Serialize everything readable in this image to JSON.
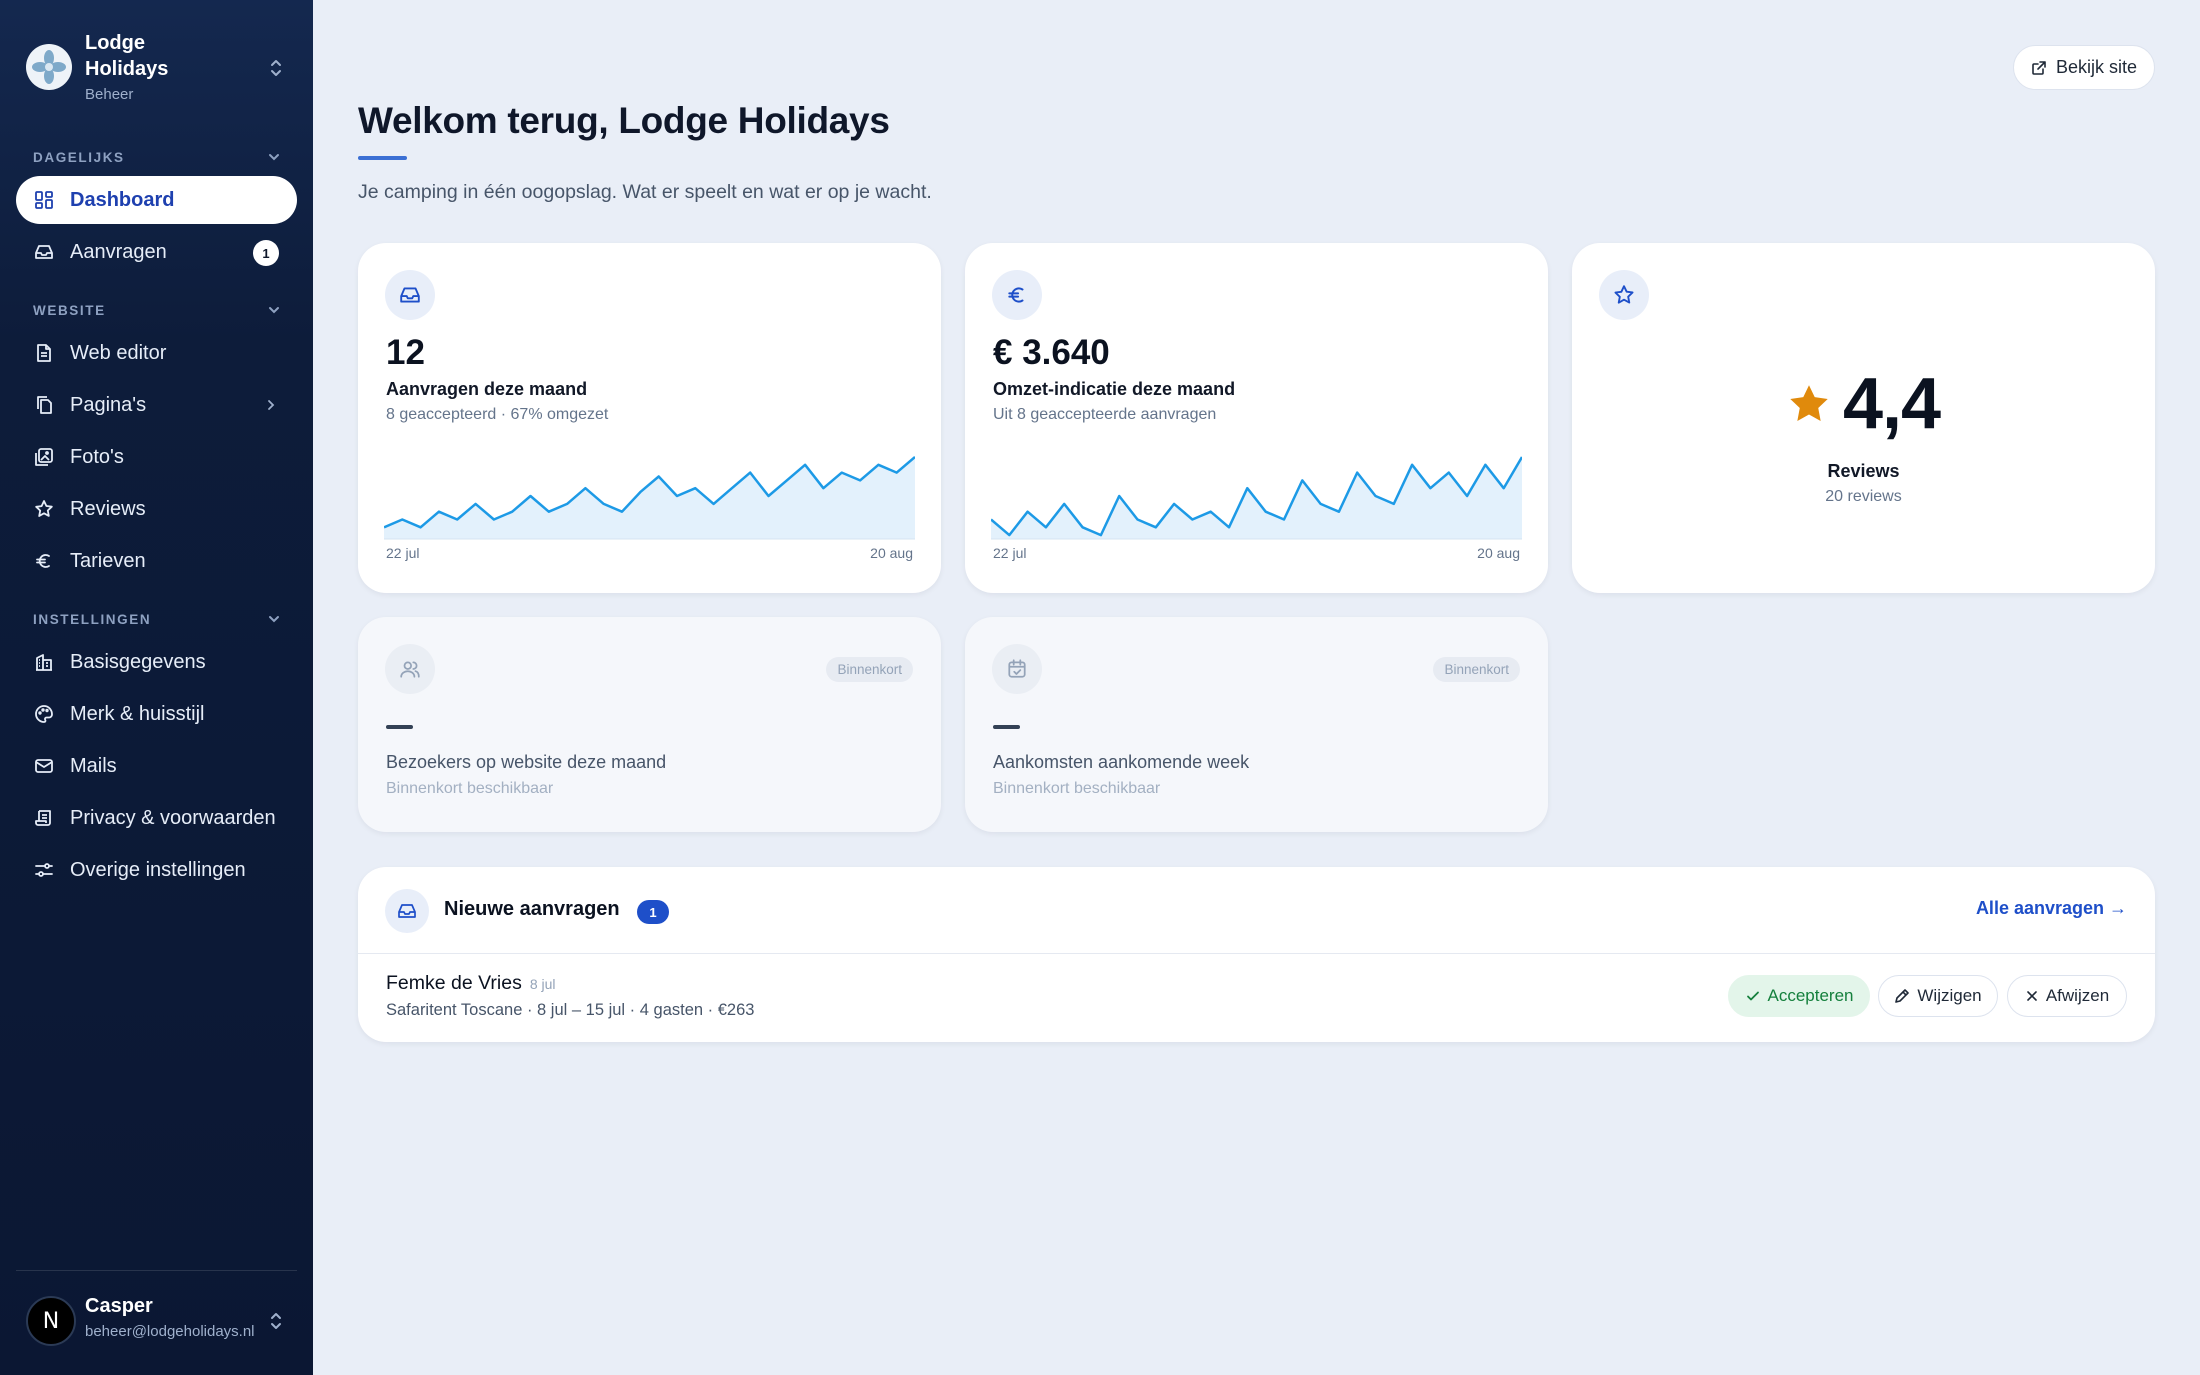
{
  "brand": {
    "name": "Lodge Holidays",
    "role": "Beheer"
  },
  "nav": {
    "sections": [
      {
        "title": "DAGELIJKS"
      },
      {
        "title": "WEBSITE"
      },
      {
        "title": "INSTELLINGEN"
      }
    ],
    "items": [
      {
        "label": "Dashboard",
        "icon": "dashboard-icon",
        "active": true
      },
      {
        "label": "Aanvragen",
        "icon": "inbox-icon",
        "badge": "1"
      },
      {
        "label": "Web editor",
        "icon": "document-icon"
      },
      {
        "label": "Pagina's",
        "icon": "pages-icon"
      },
      {
        "label": "Foto's",
        "icon": "image-icon"
      },
      {
        "label": "Reviews",
        "icon": "star-icon"
      },
      {
        "label": "Tarieven",
        "icon": "euro-icon"
      },
      {
        "label": "Basisgegevens",
        "icon": "building-icon"
      },
      {
        "label": "Merk & huisstijl",
        "icon": "palette-icon"
      },
      {
        "label": "Mails",
        "icon": "mail-icon"
      },
      {
        "label": "Privacy & voorwaarden",
        "icon": "scroll-icon"
      },
      {
        "label": "Overige instellingen",
        "icon": "sliders-icon"
      }
    ]
  },
  "user": {
    "name": "Casper",
    "email": "beheer@lodgeholidays.nl",
    "initial": "N"
  },
  "header": {
    "view_site": "Bekijk site",
    "title": "Welkom terug, Lodge Holidays",
    "subtitle": "Je camping in één oogopslag. Wat er speelt en wat er op je wacht."
  },
  "stats": {
    "requests": {
      "value": "12",
      "label": "Aanvragen deze maand",
      "sub": "8 geaccepteerd · 67% omgezet",
      "axis_start": "22 jul",
      "axis_end": "20 aug"
    },
    "revenue": {
      "value": "€ 3.640",
      "label": "Omzet-indicatie deze maand",
      "sub": "Uit 8 geaccepteerde aanvragen",
      "axis_start": "22 jul",
      "axis_end": "20 aug"
    },
    "reviews": {
      "value": "4,4",
      "label": "Reviews",
      "sub": "20 reviews"
    },
    "visitors": {
      "badge": "Binnenkort",
      "label": "Bezoekers op website deze maand",
      "sub": "Binnenkort beschikbaar"
    },
    "arrivals": {
      "badge": "Binnenkort",
      "label": "Aankomsten aankomende week",
      "sub": "Binnenkort beschikbaar"
    }
  },
  "sparklines": {
    "requests": [
      3,
      5,
      3,
      7,
      5,
      9,
      5,
      7,
      11,
      7,
      9,
      13,
      9,
      7,
      12,
      16,
      11,
      13,
      9,
      13,
      17,
      11,
      15,
      19,
      13,
      17,
      15,
      19,
      17,
      21
    ],
    "revenue": [
      5,
      1,
      7,
      3,
      9,
      3,
      1,
      11,
      5,
      3,
      9,
      5,
      7,
      3,
      13,
      7,
      5,
      15,
      9,
      7,
      17,
      11,
      9,
      19,
      13,
      17,
      11,
      19,
      13,
      21
    ]
  },
  "colors": {
    "accent": "#1e4fc9",
    "sidebar": "#0d1c3a",
    "spark": "#1d9ae6",
    "star": "#e08a0c"
  },
  "requests_panel": {
    "title": "Nieuwe aanvragen",
    "count": "1",
    "all_link": "Alle aanvragen →",
    "items": [
      {
        "name": "Femke de Vries",
        "date": "8 jul",
        "detail": "Safaritent Toscane · 8 jul – 15 jul · 4 gasten · €263"
      }
    ],
    "actions": {
      "accept": "Accepteren",
      "edit": "Wijzigen",
      "reject": "Afwijzen"
    }
  }
}
